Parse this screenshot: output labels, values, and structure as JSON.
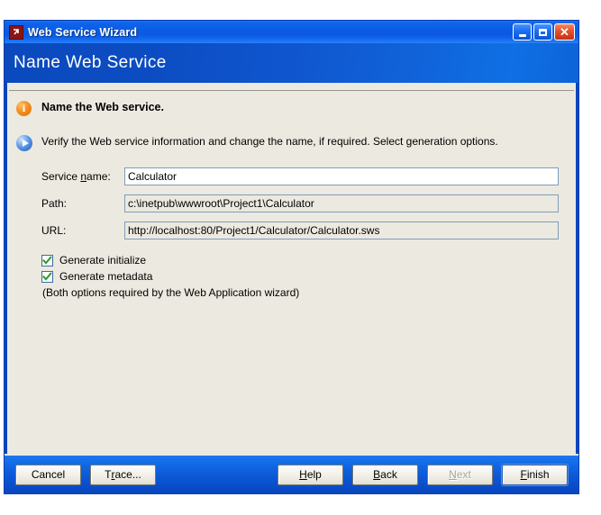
{
  "window": {
    "title": "Web Service Wizard",
    "icon": "app-shortcut-icon",
    "controls": {
      "minimize": "minimize-icon",
      "maximize": "maximize-icon",
      "close": "close-icon"
    }
  },
  "banner": {
    "title": "Name Web Service"
  },
  "info": {
    "heading": "Name the Web service.",
    "heading_icon": "info-icon",
    "description": "Verify the Web service information and change the name, if required. Select generation options.",
    "description_icon": "blue-arrow-icon"
  },
  "form": {
    "fields": [
      {
        "label_pre": "Service ",
        "label_accel": "n",
        "label_post": "ame:",
        "value": "Calculator",
        "readonly": false
      },
      {
        "label_pre": "Path:",
        "label_accel": "",
        "label_post": "",
        "value": "c:\\inetpub\\wwwroot\\Project1\\Calculator",
        "readonly": true
      },
      {
        "label_pre": "URL:",
        "label_accel": "",
        "label_post": "",
        "value": "http://localhost:80/Project1/Calculator/Calculator.sws",
        "readonly": true
      }
    ]
  },
  "options": {
    "checkboxes": [
      {
        "label": "Generate initialize",
        "checked": true
      },
      {
        "label": "Generate metadata",
        "checked": true
      }
    ],
    "note": "(Both options required by the Web Application wizard)"
  },
  "footer": {
    "left_buttons": [
      {
        "pre": "Cancel",
        "accel": "",
        "post": "",
        "state": "normal"
      },
      {
        "pre": "T",
        "accel": "r",
        "post": "ace...",
        "state": "normal"
      }
    ],
    "right_buttons": [
      {
        "pre": "",
        "accel": "H",
        "post": "elp",
        "state": "normal"
      },
      {
        "pre": "",
        "accel": "B",
        "post": "ack",
        "state": "normal"
      },
      {
        "pre": "",
        "accel": "N",
        "post": "ext",
        "state": "disabled"
      },
      {
        "pre": "",
        "accel": "F",
        "post": "inish",
        "state": "default"
      }
    ]
  },
  "colors": {
    "title_bar": "#0a5ce4",
    "banner_start": "#0b49bd",
    "banner_end": "#0c64d8",
    "client_bg": "#ece9e0",
    "frame_blue": "#0a45c0",
    "field_border": "#7f9db9",
    "check_green": "#2f9c2f",
    "info_orange": "#f59223"
  }
}
